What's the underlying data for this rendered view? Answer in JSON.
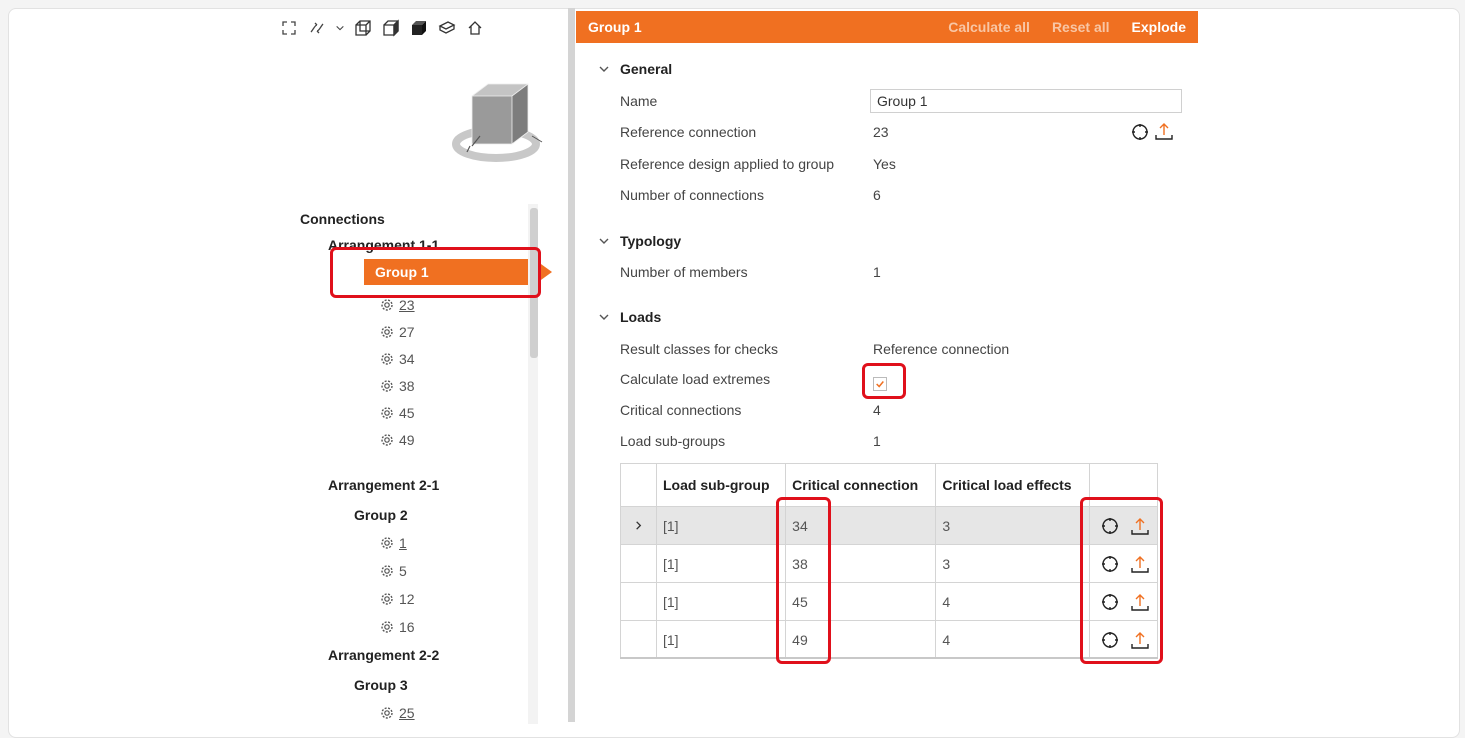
{
  "toolbar": {
    "icons": [
      "fit-view-icon",
      "rotate-icon",
      "chevron-down-icon",
      "wireframe-cube-icon",
      "shaded-cube-icon",
      "solid-cube-icon",
      "section-view-icon",
      "home-icon"
    ]
  },
  "tree": {
    "root_label": "Connections",
    "arrangements": [
      {
        "label": "Arrangement 1-1",
        "groups": [
          {
            "label": "Group 1",
            "selected": true,
            "connections": [
              "23",
              "27",
              "34",
              "38",
              "45",
              "49"
            ],
            "reference": "23"
          }
        ]
      },
      {
        "label": "Arrangement 2-1",
        "groups": [
          {
            "label": "Group 2",
            "connections": [
              "1",
              "5",
              "12",
              "16"
            ],
            "reference": "1"
          }
        ]
      },
      {
        "label": "Arrangement 2-2",
        "groups": [
          {
            "label": "Group 3",
            "connections": [
              "25"
            ],
            "reference": "25"
          }
        ]
      }
    ]
  },
  "header": {
    "title": "Group 1",
    "calculate_all": "Calculate all",
    "reset_all": "Reset all",
    "explode": "Explode"
  },
  "general": {
    "title": "General",
    "name_label": "Name",
    "name_value": "Group 1",
    "ref_conn_label": "Reference connection",
    "ref_conn_value": "23",
    "ref_design_label": "Reference design applied to group",
    "ref_design_value": "Yes",
    "num_conn_label": "Number of connections",
    "num_conn_value": "6"
  },
  "typology": {
    "title": "Typology",
    "num_members_label": "Number of members",
    "num_members_value": "1"
  },
  "loads": {
    "title": "Loads",
    "result_classes_label": "Result classes for checks",
    "result_classes_value": "Reference connection",
    "calc_extremes_label": "Calculate load extremes",
    "calc_extremes_checked": true,
    "critical_conn_label": "Critical connections",
    "critical_conn_value": "4",
    "sub_groups_label": "Load sub-groups",
    "sub_groups_value": "1"
  },
  "table": {
    "headers": [
      "Load sub-group",
      "Critical connection",
      "Critical load effects"
    ],
    "rows": [
      {
        "sub_group": "[1]",
        "critical_connection": "34",
        "critical_load_effects": "3",
        "selected": true
      },
      {
        "sub_group": "[1]",
        "critical_connection": "38",
        "critical_load_effects": "3"
      },
      {
        "sub_group": "[1]",
        "critical_connection": "45",
        "critical_load_effects": "4"
      },
      {
        "sub_group": "[1]",
        "critical_connection": "49",
        "critical_load_effects": "4"
      }
    ]
  },
  "colors": {
    "accent": "#f07021",
    "highlight": "#e0101b"
  }
}
